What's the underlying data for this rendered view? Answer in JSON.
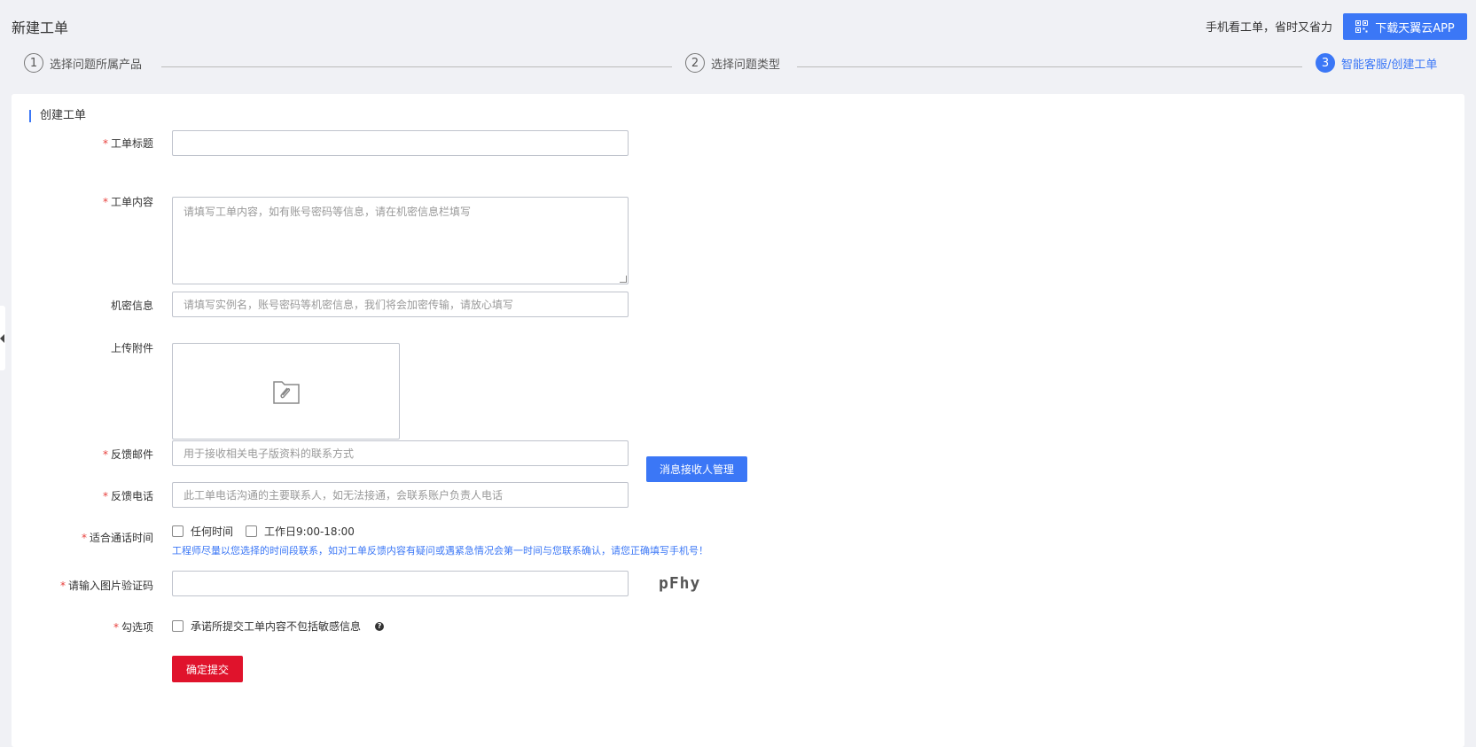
{
  "header": {
    "title": "新建工单",
    "promo_text": "手机看工单，省时又省力",
    "app_button_label": "下载天翼云APP"
  },
  "steps": [
    {
      "num": "1",
      "label": "选择问题所属产品"
    },
    {
      "num": "2",
      "label": "选择问题类型"
    },
    {
      "num": "3",
      "label": "智能客服/创建工单"
    }
  ],
  "form": {
    "section_title": "创建工单",
    "title_label": "工单标题",
    "title_value": "",
    "content_label": "工单内容",
    "content_placeholder": "请填写工单内容，如有账号密码等信息，请在机密信息栏填写",
    "secret_label": "机密信息",
    "secret_placeholder": "请填写实例名，账号密码等机密信息，我们将会加密传输，请放心填写",
    "upload_label": "上传附件",
    "email_label": "反馈邮件",
    "email_placeholder": "用于接收相关电子版资料的联系方式",
    "email_button": "消息接收人管理",
    "phone_label": "反馈电话",
    "phone_placeholder": "此工单电话沟通的主要联系人，如无法接通，会联系账户负责人电话",
    "time_label": "适合通话时间",
    "time_option_any": "任何时间",
    "time_option_workday": "工作日9:00-18:00",
    "time_notice": "工程师尽量以您选择的时间段联系，如对工单反馈内容有疑问或遇紧急情况会第一时间与您联系确认，请您正确填写手机号！",
    "captcha_label": "请输入图片验证码",
    "captcha_value": "",
    "captcha_image_text": "pFhy",
    "check_label": "勾选项",
    "check_text": "承诺所提交工单内容不包括敏感信息",
    "help_glyph": "?",
    "submit_label": "确定提交"
  },
  "colors": {
    "accent": "#3b77f6",
    "required": "#e8403d",
    "submit": "#e0132c"
  }
}
